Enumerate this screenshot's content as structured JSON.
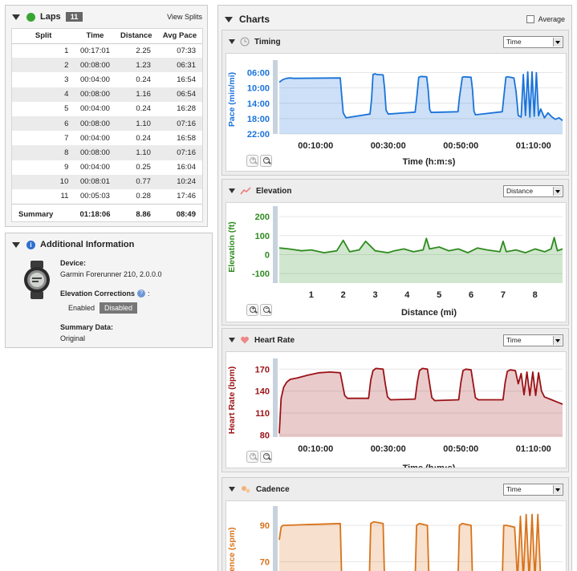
{
  "laps": {
    "title": "Laps",
    "count": "11",
    "view_splits": "View Splits",
    "columns": [
      "Split",
      "Time",
      "Distance",
      "Avg Pace"
    ],
    "rows": [
      [
        "1",
        "00:17:01",
        "2.25",
        "07:33"
      ],
      [
        "2",
        "00:08:00",
        "1.23",
        "06:31"
      ],
      [
        "3",
        "00:04:00",
        "0.24",
        "16:54"
      ],
      [
        "4",
        "00:08:00",
        "1.16",
        "06:54"
      ],
      [
        "5",
        "00:04:00",
        "0.24",
        "16:28"
      ],
      [
        "6",
        "00:08:00",
        "1.10",
        "07:16"
      ],
      [
        "7",
        "00:04:00",
        "0.24",
        "16:58"
      ],
      [
        "8",
        "00:08:00",
        "1.10",
        "07:16"
      ],
      [
        "9",
        "00:04:00",
        "0.25",
        "16:04"
      ],
      [
        "10",
        "00:08:01",
        "0.77",
        "10:24"
      ],
      [
        "11",
        "00:05:03",
        "0.28",
        "17:46"
      ]
    ],
    "summary": [
      "Summary",
      "01:18:06",
      "8.86",
      "08:49"
    ]
  },
  "info": {
    "title": "Additional Information",
    "device_label": "Device:",
    "device_value": "Garmin Forerunner 210, 2.0.0.0",
    "elevation_label": "Elevation Corrections",
    "elevation_colon": ":",
    "enabled": "Enabled",
    "disabled": "Disabled",
    "summary_label": "Summary Data:",
    "summary_value": "Original"
  },
  "charts": {
    "title": "Charts",
    "average_label": "Average",
    "zoom_in": "+",
    "zoom_out": "−"
  },
  "colors": {
    "timing": "#1a73d9",
    "elevation": "#2e8b1f",
    "heart_rate": "#9b1216",
    "cadence": "#d9731a"
  },
  "chart_data": [
    {
      "type": "area",
      "title": "Timing",
      "selector": "Time",
      "ylabel": "Pace (min/mi)",
      "xlabel": "Time (h:m:s)",
      "y_ticks": [
        "06:00",
        "10:00",
        "14:00",
        "18:00",
        "22:00"
      ],
      "y_inverted": true,
      "ylim_minutes": [
        4,
        22
      ],
      "x_ticks": [
        "00:10:00",
        "00:30:00",
        "00:50:00",
        "01:10:00"
      ],
      "xlim_minutes": [
        0,
        78
      ],
      "series": [
        {
          "x": [
            0,
            1,
            2,
            3,
            4,
            16.8,
            17.2,
            17.6,
            18,
            18.4,
            25,
            25.4,
            25.8,
            26.4,
            26.8,
            28.6,
            29,
            29.4,
            30,
            37.4,
            37.8,
            38.4,
            39,
            40.6,
            41,
            41.4,
            41.8,
            49.2,
            49.6,
            50.4,
            51,
            52.8,
            53.2,
            53.6,
            54,
            61.4,
            61.8,
            62.4,
            63,
            64.6,
            65.2,
            65.8,
            66.6,
            67.2,
            67.8,
            68.4,
            69,
            69.6,
            70.2,
            70.8,
            71.4,
            72,
            73,
            74,
            75,
            76,
            77,
            78
          ],
          "y": [
            8.5,
            7.8,
            7.5,
            7.4,
            7.5,
            7.4,
            12,
            16.5,
            17.2,
            17.8,
            16.8,
            13,
            6.5,
            6.3,
            6.5,
            6.6,
            10,
            15.8,
            16.8,
            16.3,
            13,
            7.2,
            7,
            7.1,
            10.5,
            15.6,
            16.4,
            16.2,
            12.5,
            7.2,
            7.1,
            7.2,
            10.5,
            16,
            17,
            16.2,
            12.5,
            7.2,
            7.1,
            7.4,
            11,
            17.2,
            17.6,
            6.5,
            17.2,
            5.8,
            17.6,
            5.8,
            17.4,
            6,
            17.3,
            15.5,
            17.8,
            16.5,
            17.5,
            18.2,
            17.8,
            18.5
          ]
        }
      ]
    },
    {
      "type": "area",
      "title": "Elevation",
      "selector": "Distance",
      "ylabel": "Elevation (ft)",
      "xlabel": "Distance (mi)",
      "y_ticks": [
        "200",
        "100",
        "0",
        "-100"
      ],
      "ylim": [
        -150,
        230
      ],
      "x_ticks": [
        "1",
        "2",
        "3",
        "4",
        "5",
        "6",
        "7",
        "8"
      ],
      "xlim": [
        0,
        8.86
      ],
      "series": [
        {
          "x": [
            0,
            0.3,
            0.7,
            1,
            1.4,
            1.8,
            2,
            2.2,
            2.5,
            2.7,
            3,
            3.4,
            3.6,
            3.9,
            4.2,
            4.5,
            4.6,
            4.7,
            5,
            5.3,
            5.6,
            5.9,
            6.2,
            6.5,
            6.9,
            7,
            7.1,
            7.4,
            7.7,
            8,
            8.3,
            8.5,
            8.6,
            8.7,
            8.86
          ],
          "y": [
            35,
            30,
            20,
            25,
            10,
            20,
            75,
            15,
            25,
            70,
            20,
            10,
            20,
            30,
            15,
            25,
            85,
            30,
            40,
            20,
            30,
            10,
            35,
            25,
            15,
            70,
            15,
            25,
            10,
            30,
            15,
            30,
            90,
            20,
            30
          ]
        }
      ]
    },
    {
      "type": "area",
      "title": "Heart Rate",
      "selector": "Time",
      "ylabel": "Heart Rate (bpm)",
      "xlabel": "Time (h:m:s)",
      "y_ticks": [
        "170",
        "140",
        "110",
        "80"
      ],
      "ylim": [
        77,
        178
      ],
      "x_ticks": [
        "00:10:00",
        "00:30:00",
        "00:50:00",
        "01:10:00"
      ],
      "xlim_minutes": [
        0,
        78
      ],
      "series": [
        {
          "x": [
            0,
            0.5,
            1.2,
            2,
            3,
            5,
            8,
            11,
            14,
            16.8,
            17.4,
            18,
            18.8,
            24.6,
            25.2,
            25.8,
            26.6,
            28.6,
            29.2,
            29.8,
            30.6,
            37.4,
            38,
            38.6,
            39.4,
            40.8,
            41.4,
            42,
            42.8,
            49.4,
            50,
            50.6,
            51.4,
            52.8,
            53.4,
            54,
            54.8,
            61.6,
            62.2,
            62.8,
            63.6,
            65,
            65.8,
            66.6,
            67.4,
            68.2,
            69,
            69.8,
            70.6,
            71.4,
            72.2,
            73,
            75,
            77,
            78
          ],
          "y": [
            82,
            130,
            145,
            152,
            156,
            158,
            162,
            165,
            166,
            165,
            150,
            134,
            130,
            130,
            155,
            168,
            171,
            170,
            150,
            132,
            128,
            129,
            152,
            168,
            171,
            170,
            150,
            131,
            127,
            128,
            152,
            168,
            170,
            169,
            150,
            131,
            128,
            128,
            152,
            167,
            169,
            168,
            150,
            164,
            135,
            166,
            134,
            166,
            134,
            165,
            140,
            132,
            128,
            124,
            122
          ]
        }
      ]
    },
    {
      "type": "area",
      "title": "Cadence",
      "selector": "Time",
      "ylabel": "Cadence (spm)",
      "y_ticks": [
        "90",
        "70"
      ],
      "ylim": [
        60,
        98
      ],
      "xlim_minutes": [
        0,
        78
      ],
      "series": [
        {
          "x": [
            0,
            0.5,
            1,
            16.8,
            17.2,
            18,
            24.8,
            25.2,
            26,
            28.6,
            29,
            30,
            37.4,
            37.8,
            38.6,
            40.8,
            41.2,
            42,
            49.2,
            49.6,
            50.4,
            52.8,
            53.2,
            54,
            61.4,
            61.8,
            62.6,
            64.8,
            65.6,
            66.4,
            67.2,
            68,
            68.8,
            69.6,
            70.4,
            71.2,
            72
          ],
          "y": [
            82,
            89,
            90,
            91,
            60,
            60,
            60,
            91,
            92,
            91,
            60,
            60,
            60,
            90,
            91,
            90,
            60,
            60,
            60,
            90,
            91,
            90,
            60,
            60,
            60,
            90,
            90,
            89,
            60,
            95,
            60,
            96,
            60,
            96,
            60,
            96,
            60
          ]
        }
      ]
    }
  ]
}
